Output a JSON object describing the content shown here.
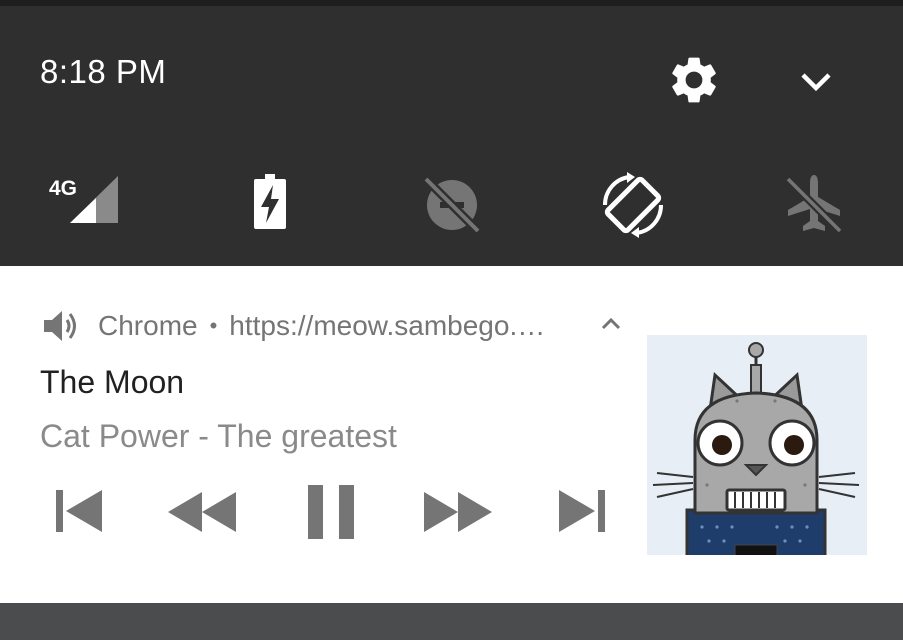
{
  "status": {
    "time": "8:18 PM"
  },
  "quick_settings": {
    "network_type": "4G",
    "tiles": [
      {
        "icon": "signal-4g-icon",
        "state": "on"
      },
      {
        "icon": "battery-charging-icon",
        "state": "on"
      },
      {
        "icon": "data-saver-off-icon",
        "state": "off"
      },
      {
        "icon": "auto-rotate-icon",
        "state": "on"
      },
      {
        "icon": "airplane-mode-off-icon",
        "state": "off"
      }
    ]
  },
  "notification": {
    "app_name": "Chrome",
    "separator": "•",
    "origin": "https://meow.sambego.…",
    "title": "The Moon",
    "subtitle": "Cat Power - The greatest",
    "controls": [
      "skip-previous-icon",
      "rewind-icon",
      "pause-icon",
      "fast-forward-icon",
      "skip-next-icon"
    ]
  },
  "colors": {
    "panel_bg": "#2f2f2f",
    "icon_on": "#ffffff",
    "icon_off": "#757575",
    "control_gray": "#757575",
    "title_text": "#212121",
    "subtitle_text": "#8a8a8a"
  }
}
